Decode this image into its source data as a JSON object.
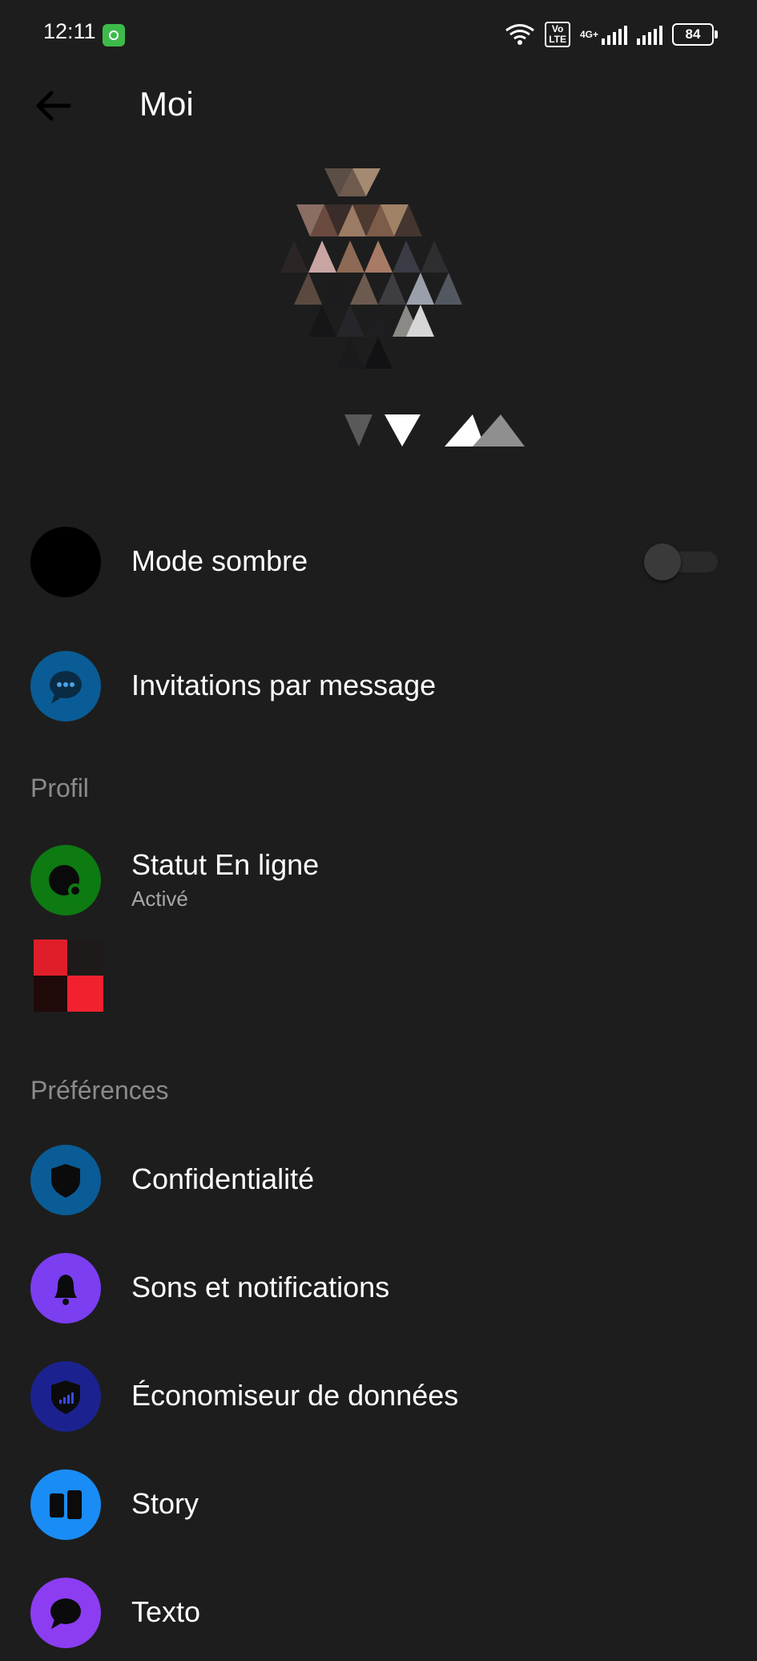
{
  "status_bar": {
    "time": "12:11",
    "network_type": "4G+",
    "volte": "Vo\nLTE",
    "battery": "84"
  },
  "header": {
    "title": "Moi"
  },
  "rows": {
    "dark_mode": {
      "label": "Mode sombre",
      "enabled": false
    },
    "message_invitations": {
      "label": "Invitations par message"
    }
  },
  "sections": {
    "profile": "Profil",
    "preferences": "Préférences"
  },
  "profile_items": {
    "online_status": {
      "label": "Statut En ligne",
      "value": "Activé"
    }
  },
  "preferences_items": {
    "privacy": {
      "label": "Confidentialité"
    },
    "sounds": {
      "label": "Sons et notifications"
    },
    "data_saver": {
      "label": "Économiseur de données"
    },
    "story": {
      "label": "Story"
    },
    "sms": {
      "label": "Texto"
    }
  },
  "colors": {
    "background": "#1d1d1d",
    "messenger_blue": "#0a5c96",
    "online_green": "#0d7a12",
    "notification_purple": "#7b3ef0",
    "data_saver_navy": "#1b2290",
    "story_blue": "#1a8cf5",
    "sms_purple": "#8c3df2"
  },
  "icons": {
    "back": "arrow-left-icon",
    "dark_mode": "moon-icon",
    "message_invitations": "chat-bubble-dots-icon",
    "online_status": "online-dot-icon",
    "privacy": "shield-icon",
    "sounds": "bell-icon",
    "data_saver": "shield-signal-icon",
    "story": "story-icon",
    "sms": "speech-bubble-icon"
  }
}
